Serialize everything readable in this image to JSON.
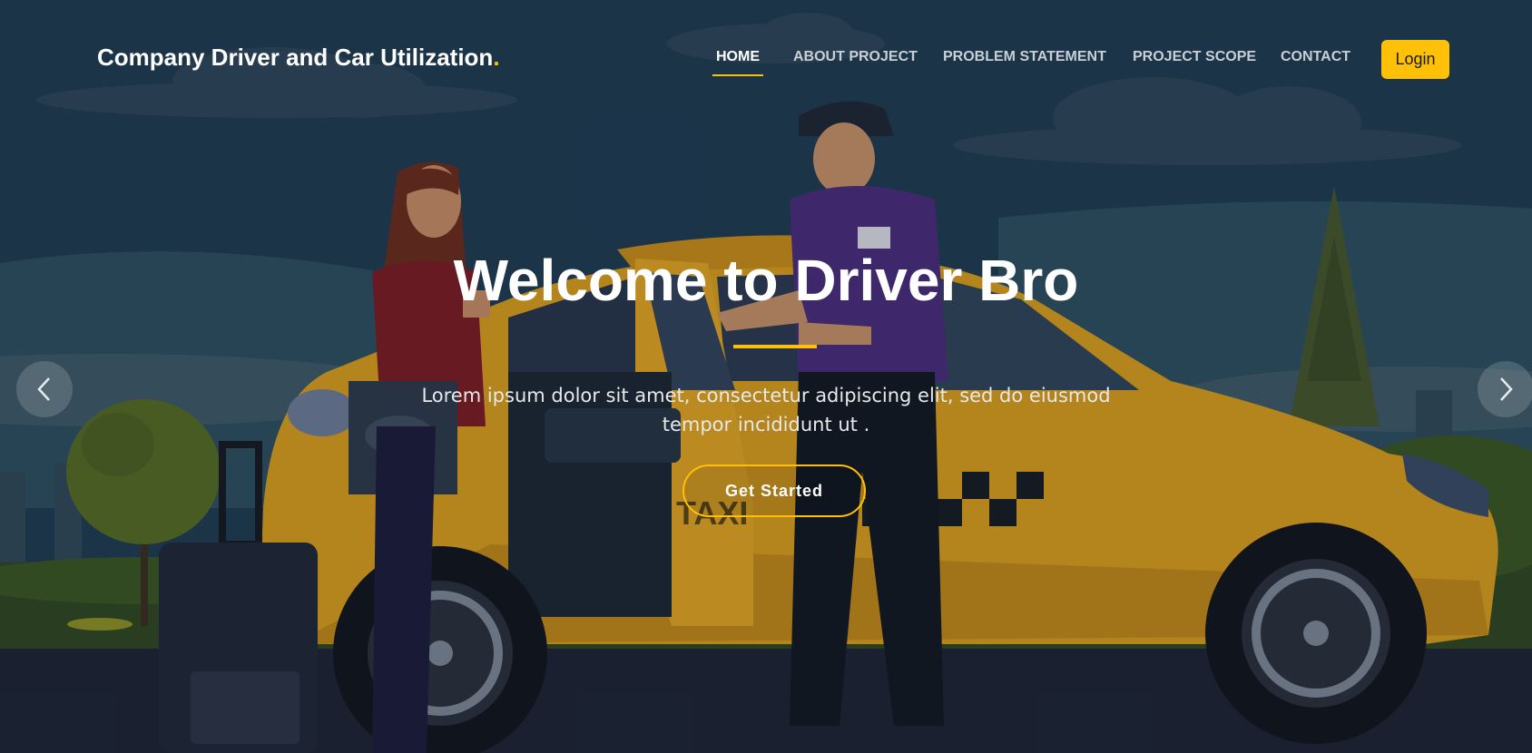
{
  "header": {
    "brand": "Company Driver and Car Utilization",
    "brand_dot": ".",
    "nav": [
      {
        "label": "HOME",
        "active": true
      },
      {
        "label": "ABOUT PROJECT",
        "active": false
      },
      {
        "label": "PROBLEM STATEMENT",
        "active": false
      },
      {
        "label": "PROJECT SCOPE",
        "active": false
      },
      {
        "label": "CONTACT",
        "active": false
      }
    ],
    "login_label": "Login"
  },
  "hero": {
    "title": "Welcome to Driver Bro",
    "text_line1": "Lorem ipsum dolor sit amet, consectetur adipiscing elit, sed do eiusmod",
    "text_line2": "tempor incididunt ut .",
    "cta_label": "Get Started",
    "car_decal": "TAXI"
  },
  "carousel": {
    "prev_icon": "chevron-left-icon",
    "next_icon": "chevron-right-icon"
  },
  "colors": {
    "accent": "#ffc107",
    "taxi_yellow": "#e0a21b",
    "sky": "#1e3a52"
  }
}
